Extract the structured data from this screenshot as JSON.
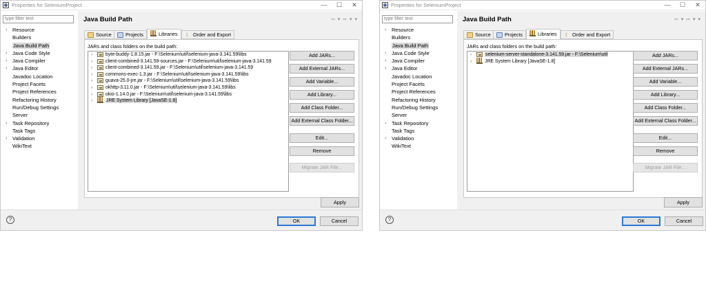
{
  "dialogs": [
    {
      "window_title": "Properties for SeleniumProject",
      "window_controls": {
        "minimize": "—",
        "maximize": "☐",
        "close": "✕"
      },
      "filter_placeholder": "type filter text",
      "tree": [
        {
          "label": "Resource",
          "expandable": true
        },
        {
          "label": "Builders",
          "expandable": false
        },
        {
          "label": "Java Build Path",
          "expandable": false,
          "selected": true
        },
        {
          "label": "Java Code Style",
          "expandable": true
        },
        {
          "label": "Java Compiler",
          "expandable": true
        },
        {
          "label": "Java Editor",
          "expandable": true
        },
        {
          "label": "Javadoc Location",
          "expandable": false
        },
        {
          "label": "Project Facets",
          "expandable": false
        },
        {
          "label": "Project References",
          "expandable": false
        },
        {
          "label": "Refactoring History",
          "expandable": false
        },
        {
          "label": "Run/Debug Settings",
          "expandable": false
        },
        {
          "label": "Server",
          "expandable": false
        },
        {
          "label": "Task Repository",
          "expandable": true
        },
        {
          "label": "Task Tags",
          "expandable": false
        },
        {
          "label": "Validation",
          "expandable": true
        },
        {
          "label": "WikiText",
          "expandable": false
        }
      ],
      "page_title": "Java Build Path",
      "nav_icons": "⇦ ▾ ⇨ ▾ ▾",
      "tabs": [
        {
          "label": "Source",
          "icon": "source-folder-icon"
        },
        {
          "label": "Projects",
          "icon": "projects-icon"
        },
        {
          "label": "Libraries",
          "icon": "libraries-icon",
          "active": true
        },
        {
          "label": "Order and Export",
          "icon": "order-export-icon"
        }
      ],
      "panel_label": "JARs and class folders on the build path:",
      "entries": [
        {
          "label": "byte-buddy-1.8.15.jar - F:\\Selenium\\util\\selenium-java-3.141.59\\libs",
          "icon": "jar-icon"
        },
        {
          "label": "client-combined-3.141.59-sources.jar - F:\\Selenium\\util\\selenium-java-3.141.59",
          "icon": "jar-icon"
        },
        {
          "label": "client-combined-3.141.59.jar - F:\\Selenium\\util\\selenium-java-3.141.59",
          "icon": "jar-icon"
        },
        {
          "label": "commons-exec-1.3.jar - F:\\Selenium\\util\\selenium-java-3.141.59\\libs",
          "icon": "jar-icon"
        },
        {
          "label": "guava-25.0-jre.jar - F:\\Selenium\\util\\selenium-java-3.141.59\\libs",
          "icon": "jar-icon"
        },
        {
          "label": "okhttp-3.11.0.jar - F:\\Selenium\\util\\selenium-java-3.141.59\\libs",
          "icon": "jar-icon"
        },
        {
          "label": "okio-1.14.0.jar - F:\\Selenium\\util\\selenium-java-3.141.59\\libs",
          "icon": "jar-icon"
        },
        {
          "label": "JRE System Library [JavaSE-1.8]",
          "icon": "library-icon",
          "selected": true
        }
      ],
      "buttons": [
        {
          "label": "Add JARs...",
          "enabled": true
        },
        {
          "label": "Add External JARs...",
          "enabled": true
        },
        {
          "label": "Add Variable...",
          "enabled": true
        },
        {
          "label": "Add Library...",
          "enabled": true
        },
        {
          "label": "Add Class Folder...",
          "enabled": true
        },
        {
          "label": "Add External Class Folder...",
          "enabled": true
        },
        {
          "label": "Edit...",
          "enabled": true
        },
        {
          "label": "Remove",
          "enabled": true
        },
        {
          "label": "Migrate JAR File...",
          "enabled": false
        }
      ],
      "apply_label": "Apply",
      "help_label": "?",
      "ok_label": "OK",
      "cancel_label": "Cancel"
    },
    {
      "window_title": "Properties for SeleniumProject",
      "window_controls": {
        "minimize": "—",
        "maximize": "☐",
        "close": "✕"
      },
      "filter_placeholder": "type filter text",
      "tree": [
        {
          "label": "Resource",
          "expandable": true
        },
        {
          "label": "Builders",
          "expandable": false
        },
        {
          "label": "Java Build Path",
          "expandable": false,
          "selected": true
        },
        {
          "label": "Java Code Style",
          "expandable": true
        },
        {
          "label": "Java Compiler",
          "expandable": true
        },
        {
          "label": "Java Editor",
          "expandable": true
        },
        {
          "label": "Javadoc Location",
          "expandable": false
        },
        {
          "label": "Project Facets",
          "expandable": false
        },
        {
          "label": "Project References",
          "expandable": false
        },
        {
          "label": "Refactoring History",
          "expandable": false
        },
        {
          "label": "Run/Debug Settings",
          "expandable": false
        },
        {
          "label": "Server",
          "expandable": false
        },
        {
          "label": "Task Repository",
          "expandable": true
        },
        {
          "label": "Task Tags",
          "expandable": false
        },
        {
          "label": "Validation",
          "expandable": true
        },
        {
          "label": "WikiText",
          "expandable": false
        }
      ],
      "page_title": "Java Build Path",
      "nav_icons": "⇦ ▾ ⇨ ▾ ▾",
      "tabs": [
        {
          "label": "Source",
          "icon": "source-folder-icon"
        },
        {
          "label": "Projects",
          "icon": "projects-icon"
        },
        {
          "label": "Libraries",
          "icon": "libraries-icon",
          "active": true
        },
        {
          "label": "Order and Export",
          "icon": "order-export-icon"
        }
      ],
      "panel_label": "JARs and class folders on the build path:",
      "entries": [
        {
          "label": "selenium-server-standalone-3.141.59.jar - F:\\Selenium\\util",
          "icon": "jar-icon",
          "selected": true
        },
        {
          "label": "JRE System Library [JavaSE-1.8]",
          "icon": "library-icon"
        }
      ],
      "buttons": [
        {
          "label": "Add JARs...",
          "enabled": true
        },
        {
          "label": "Add External JARs...",
          "enabled": true
        },
        {
          "label": "Add Variable...",
          "enabled": true
        },
        {
          "label": "Add Library...",
          "enabled": true
        },
        {
          "label": "Add Class Folder...",
          "enabled": true
        },
        {
          "label": "Add External Class Folder...",
          "enabled": true
        },
        {
          "label": "Edit...",
          "enabled": true
        },
        {
          "label": "Remove",
          "enabled": true
        },
        {
          "label": "Migrate JAR File...",
          "enabled": false
        }
      ],
      "apply_label": "Apply",
      "help_label": "?",
      "ok_label": "OK",
      "cancel_label": "Cancel"
    }
  ]
}
